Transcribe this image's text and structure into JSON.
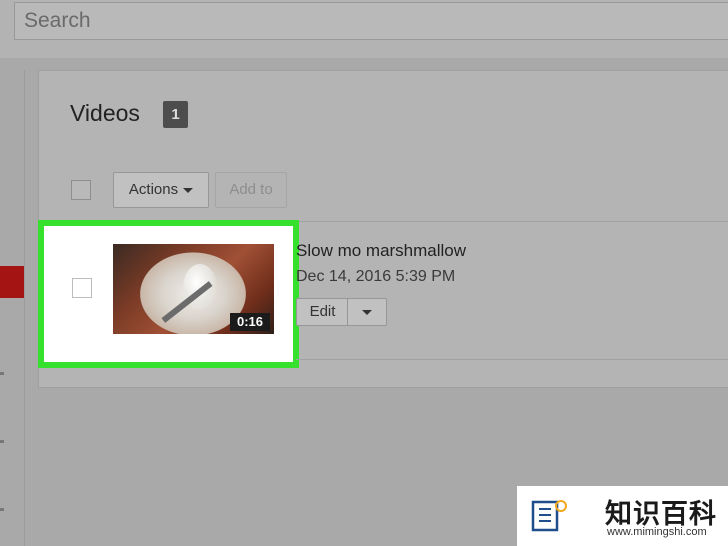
{
  "search": {
    "placeholder": "Search"
  },
  "videos": {
    "title": "Videos",
    "count": "1"
  },
  "toolbar": {
    "actions_label": "Actions",
    "add_to_label": "Add to"
  },
  "video": {
    "title": "Slow mo marshmallow",
    "date": "Dec 14, 2016 5:39 PM",
    "duration": "0:16",
    "edit_label": "Edit"
  },
  "watermark": {
    "name": "知识百科",
    "url": "www.mimingshi.com"
  },
  "colors": {
    "highlight": "#35e12c",
    "sidebar_active": "#a31413"
  }
}
